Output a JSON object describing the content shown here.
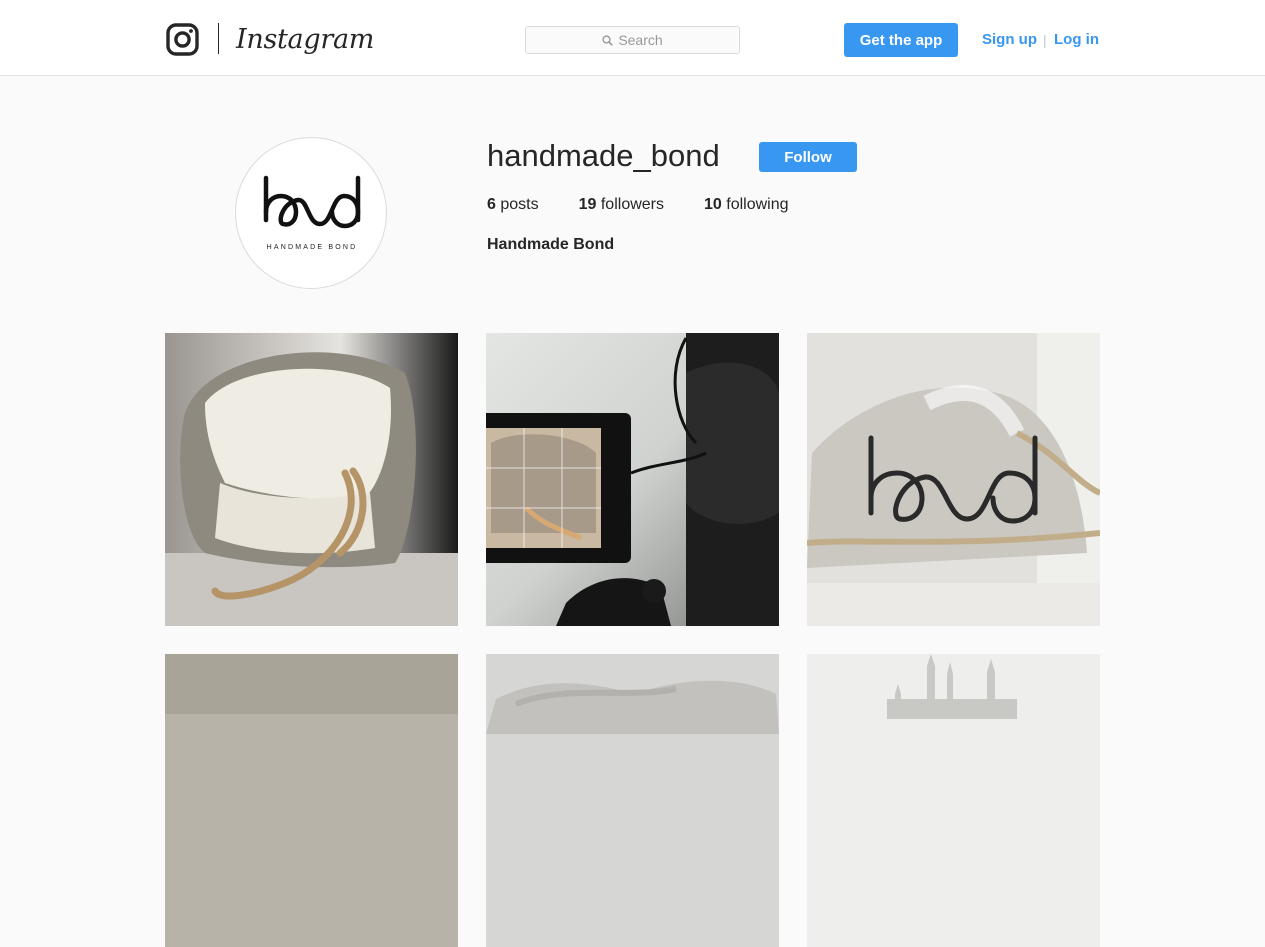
{
  "header": {
    "brand": "Instagram",
    "search_placeholder": "Search",
    "get_app_label": "Get the app",
    "signup_label": "Sign up",
    "separator": "|",
    "login_label": "Log in",
    "accent": "#3897f0"
  },
  "profile": {
    "username": "handmade_bond",
    "follow_label": "Follow",
    "posts_count": "6",
    "posts_label": "posts",
    "followers_count": "19",
    "followers_label": "followers",
    "following_count": "10",
    "following_label": "following",
    "full_name": "Handmade Bond",
    "avatar_text": "HANDMADE BOND"
  },
  "posts": [
    {
      "subject": "linen bag with rope handle"
    },
    {
      "subject": "camera monitor filming bag"
    },
    {
      "subject": "bond logo over bag"
    },
    {
      "subject": "fabric texture"
    },
    {
      "subject": "rope texture"
    },
    {
      "subject": "cathedral skyline"
    }
  ]
}
